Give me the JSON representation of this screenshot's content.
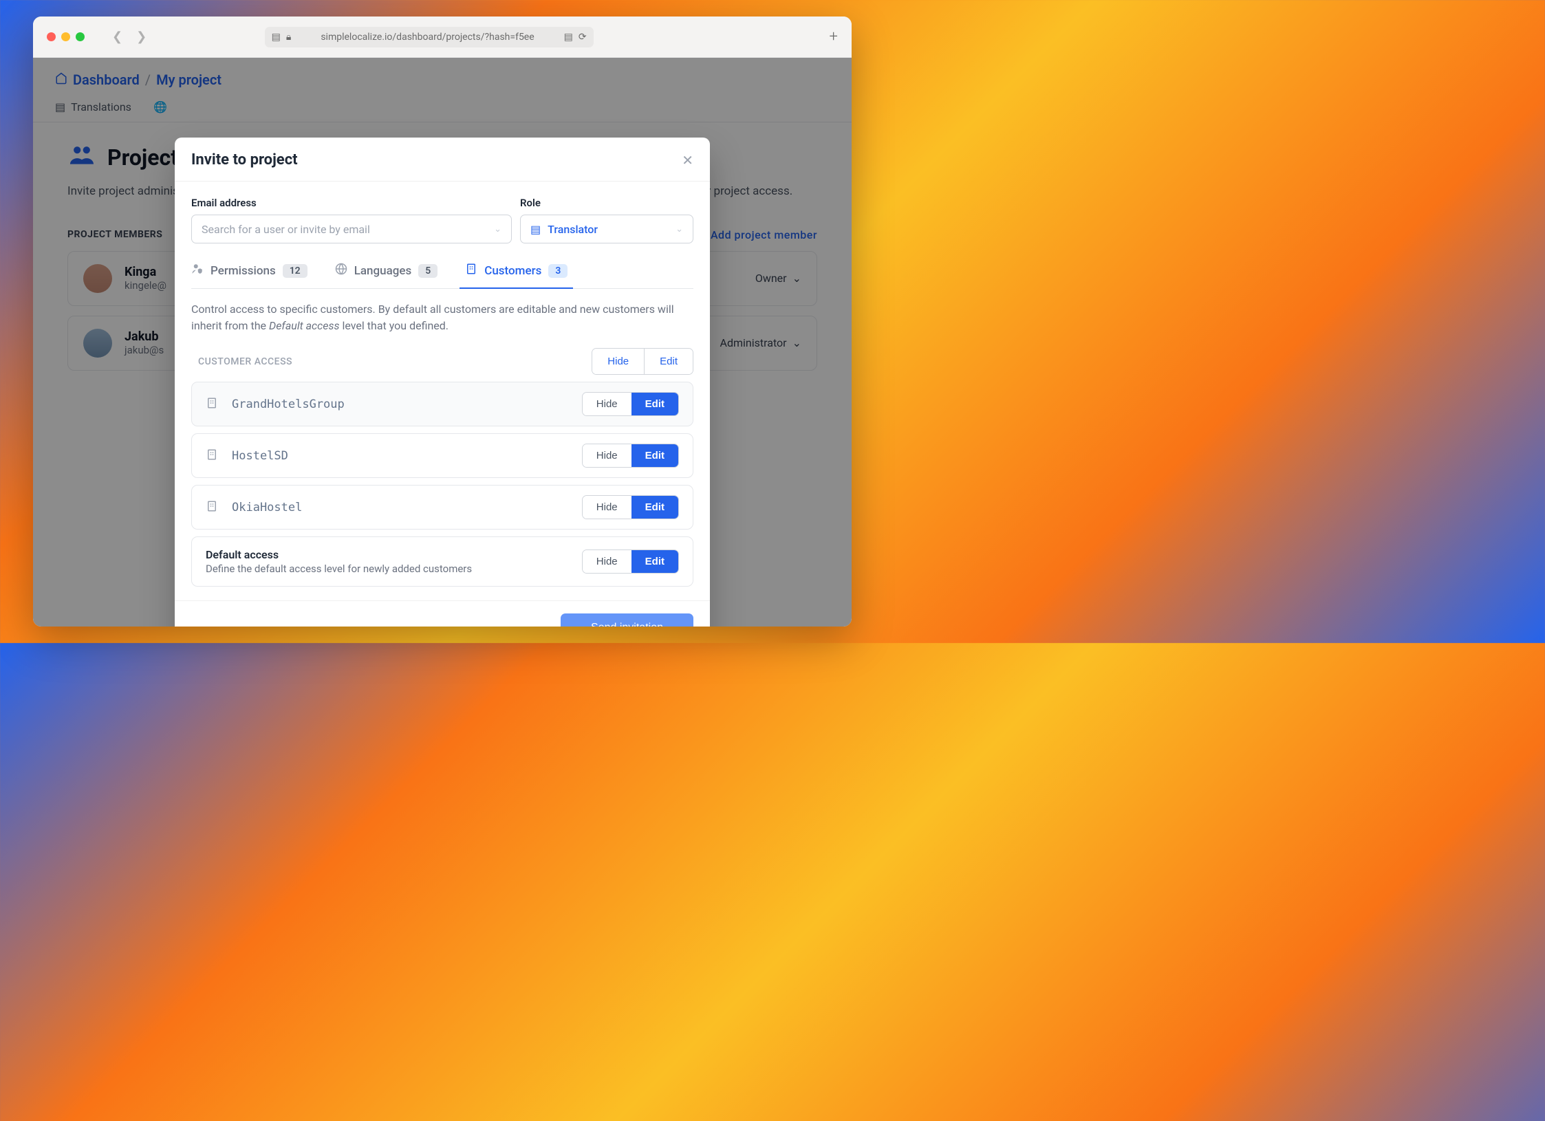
{
  "browser": {
    "url": "simplelocalize.io/dashboard/projects/?hash=f5ee"
  },
  "breadcrumb": {
    "home": "Dashboard",
    "project": "My project"
  },
  "nav_tabs": {
    "translations": "Translations"
  },
  "page": {
    "title": "Project",
    "description": "Invite project administrators, managers, project editors and translators to your project. Invite organization team members for project access.",
    "section_label": "PROJECT MEMBERS",
    "add_link": "Add project member"
  },
  "members": [
    {
      "name": "Kinga",
      "email": "kingele@",
      "role": "Owner"
    },
    {
      "name": "Jakub",
      "email": "jakub@s",
      "role": "Administrator"
    }
  ],
  "modal": {
    "title": "Invite to project",
    "email_label": "Email address",
    "email_placeholder": "Search for a user or invite by email",
    "role_label": "Role",
    "role_value": "Translator",
    "tabs": {
      "permissions": {
        "label": "Permissions",
        "count": "12"
      },
      "languages": {
        "label": "Languages",
        "count": "5"
      },
      "customers": {
        "label": "Customers",
        "count": "3"
      }
    },
    "help_text_1": "Control access to specific customers. By default all customers are editable and new customers will inherit from the ",
    "help_text_em": "Default access",
    "help_text_2": " level that you defined.",
    "access_header": "CUSTOMER ACCESS",
    "header_hide": "Hide",
    "header_edit": "Edit",
    "row_hide": "Hide",
    "row_edit": "Edit",
    "customers": [
      {
        "name": "GrandHotelsGroup"
      },
      {
        "name": "HostelSD"
      },
      {
        "name": "OkiaHostel"
      }
    ],
    "default": {
      "title": "Default access",
      "desc": "Define the default access level for newly added customers"
    },
    "send_button": "Send invitation"
  }
}
